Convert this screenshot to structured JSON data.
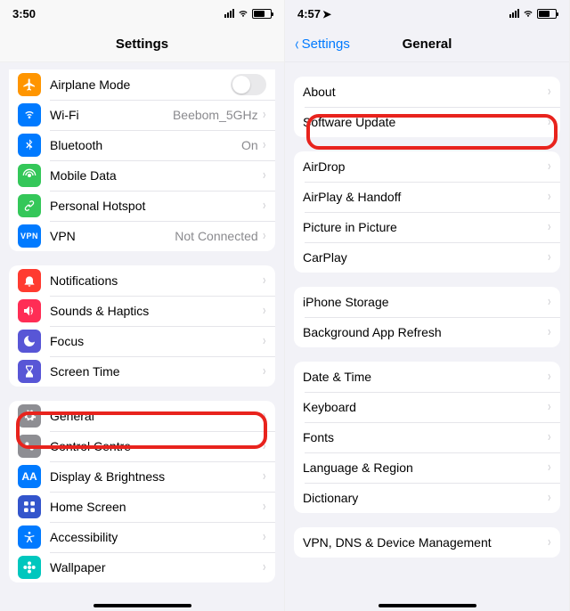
{
  "left": {
    "status": {
      "time": "3:50"
    },
    "nav": {
      "title": "Settings"
    },
    "g1": {
      "airplane": "Airplane Mode",
      "wifi": "Wi-Fi",
      "wifi_val": "Beebom_5GHz",
      "bt": "Bluetooth",
      "bt_val": "On",
      "mobile": "Mobile Data",
      "hotspot": "Personal Hotspot",
      "vpn": "VPN",
      "vpn_val": "Not Connected"
    },
    "g2": {
      "notif": "Notifications",
      "sounds": "Sounds & Haptics",
      "focus": "Focus",
      "screentime": "Screen Time"
    },
    "g3": {
      "general": "General",
      "control": "Control Centre",
      "display": "Display & Brightness",
      "home": "Home Screen",
      "access": "Accessibility",
      "wallpaper": "Wallpaper"
    },
    "icon_colors": {
      "airplane": "#ff9500",
      "wifi": "#007aff",
      "bt": "#007aff",
      "mobile": "#34c759",
      "hotspot": "#34c759",
      "vpn": "#007aff",
      "notif": "#ff3b30",
      "sounds": "#ff2d55",
      "focus": "#5856d6",
      "screentime": "#5856d6",
      "general": "#8e8e93",
      "control": "#8e8e93",
      "display": "#007aff",
      "home": "#3355cc",
      "access": "#007aff",
      "wallpaper": "#00c7be"
    }
  },
  "right": {
    "status": {
      "time": "4:57"
    },
    "nav": {
      "back": "Settings",
      "title": "General"
    },
    "g1": {
      "about": "About",
      "software": "Software Update"
    },
    "g2": {
      "airdrop": "AirDrop",
      "airplay": "AirPlay & Handoff",
      "pip": "Picture in Picture",
      "carplay": "CarPlay"
    },
    "g3": {
      "storage": "iPhone Storage",
      "refresh": "Background App Refresh"
    },
    "g4": {
      "date": "Date & Time",
      "keyboard": "Keyboard",
      "fonts": "Fonts",
      "lang": "Language & Region",
      "dict": "Dictionary"
    },
    "g5": {
      "vpn": "VPN, DNS & Device Management"
    }
  }
}
